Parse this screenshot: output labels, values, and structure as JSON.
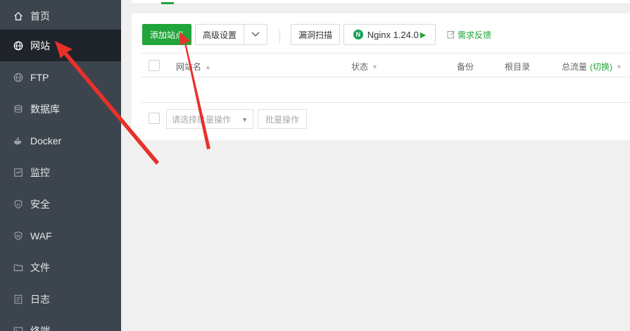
{
  "sidebar": {
    "items": [
      {
        "label": "首页",
        "icon": "home-icon"
      },
      {
        "label": "网站",
        "icon": "globe-icon"
      },
      {
        "label": "FTP",
        "icon": "ftp-globe-icon"
      },
      {
        "label": "数据库",
        "icon": "database-icon"
      },
      {
        "label": "Docker",
        "icon": "docker-icon"
      },
      {
        "label": "监控",
        "icon": "monitor-icon"
      },
      {
        "label": "安全",
        "icon": "shield-icon"
      },
      {
        "label": "WAF",
        "icon": "waf-shield-icon"
      },
      {
        "label": "文件",
        "icon": "folder-icon"
      },
      {
        "label": "日志",
        "icon": "log-icon"
      },
      {
        "label": "终端",
        "icon": "terminal-icon"
      }
    ],
    "active_index": 1
  },
  "toolbar": {
    "add_site": "添加站点",
    "advanced": "高级设置",
    "scan": "漏洞扫描",
    "nginx": "Nginx 1.24.0",
    "feedback": "需求反馈"
  },
  "table": {
    "columns": {
      "name": "网站名",
      "status": "状态",
      "remark": "备份",
      "root": "根目录",
      "traffic": "总流量",
      "traffic_switch": "(切换)"
    }
  },
  "batch": {
    "select_placeholder": "请选择批量操作",
    "button": "批量操作"
  },
  "colors": {
    "sidebar_bg": "#3c444d",
    "sidebar_active": "#1e242a",
    "accent": "#20a53a",
    "annotation_arrow": "#e8312a"
  }
}
